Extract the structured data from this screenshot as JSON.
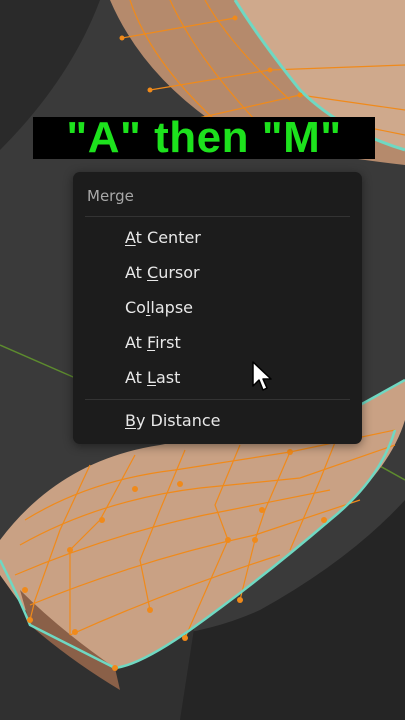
{
  "overlay": {
    "caption": "\"A\" then \"M\""
  },
  "menu": {
    "title": "Merge",
    "items": [
      {
        "pre": "",
        "key": "A",
        "post": "t Center"
      },
      {
        "pre": "At ",
        "key": "C",
        "post": "ursor"
      },
      {
        "pre": "Co",
        "key": "l",
        "post": "lapse"
      },
      {
        "pre": "At ",
        "key": "F",
        "post": "irst"
      },
      {
        "pre": "At ",
        "key": "L",
        "post": "ast"
      },
      {
        "pre": "",
        "key": "B",
        "post": "y Distance"
      }
    ]
  },
  "colors": {
    "caption_text": "#1de21d",
    "caption_bg": "#000000",
    "mesh_face": "#c9a184",
    "mesh_edge": "#f08a1a",
    "boundary": "#6fd8c2",
    "menu_bg": "#1c1c1c"
  },
  "icons": {
    "cursor": "arrow-cursor-icon"
  }
}
